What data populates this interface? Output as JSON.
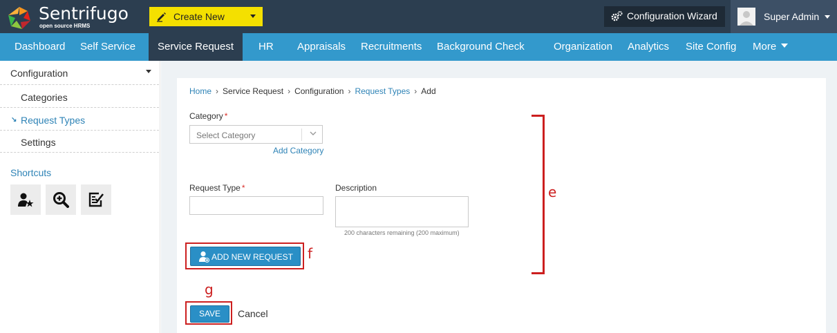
{
  "app": {
    "brand_name": "Sentrifugo",
    "brand_tagline": "open source HRMS",
    "create_new_label": "Create New",
    "config_wizard_label": "Configuration Wizard",
    "user_name": "Super Admin"
  },
  "nav": {
    "items": [
      {
        "label": "Dashboard"
      },
      {
        "label": "Self Service"
      },
      {
        "label": "Service Request",
        "active": true
      },
      {
        "label": "HR"
      },
      {
        "label": "Appraisals"
      },
      {
        "label": "Recruitments"
      },
      {
        "label": "Background Check"
      },
      {
        "label": "Organization"
      },
      {
        "label": "Analytics"
      },
      {
        "label": "Site Config"
      },
      {
        "label": "More"
      }
    ]
  },
  "sidebar": {
    "section_title": "Configuration",
    "items": [
      {
        "label": "Categories"
      },
      {
        "label": "Request Types",
        "active": true
      },
      {
        "label": "Settings"
      }
    ],
    "shortcuts_title": "Shortcuts",
    "shortcuts": [
      "user-star-icon",
      "zoom-in-icon",
      "checklist-icon"
    ]
  },
  "breadcrumb": {
    "items": [
      "Home",
      "Service Request",
      "Configuration",
      "Request Types",
      "Add"
    ],
    "separator": "›"
  },
  "form": {
    "category_label": "Category",
    "required_mark": "*",
    "category_placeholder": "Select Category",
    "add_category_label": "Add Category",
    "request_type_label": "Request Type",
    "request_type_value": "",
    "description_label": "Description",
    "description_value": "",
    "char_count": "200 characters remaining (200 maximum)",
    "add_new_request_label": "ADD NEW REQUEST",
    "save_label": "SAVE",
    "cancel_label": "Cancel"
  },
  "annotations": {
    "e": "e",
    "f": "f",
    "g": "g"
  },
  "colors": {
    "topbar": "#2c3e50",
    "nav": "#3399cc",
    "create_new": "#f4e000",
    "button": "#2a8fc6",
    "link": "#2e83b6",
    "highlight": "#cc1f1f"
  }
}
